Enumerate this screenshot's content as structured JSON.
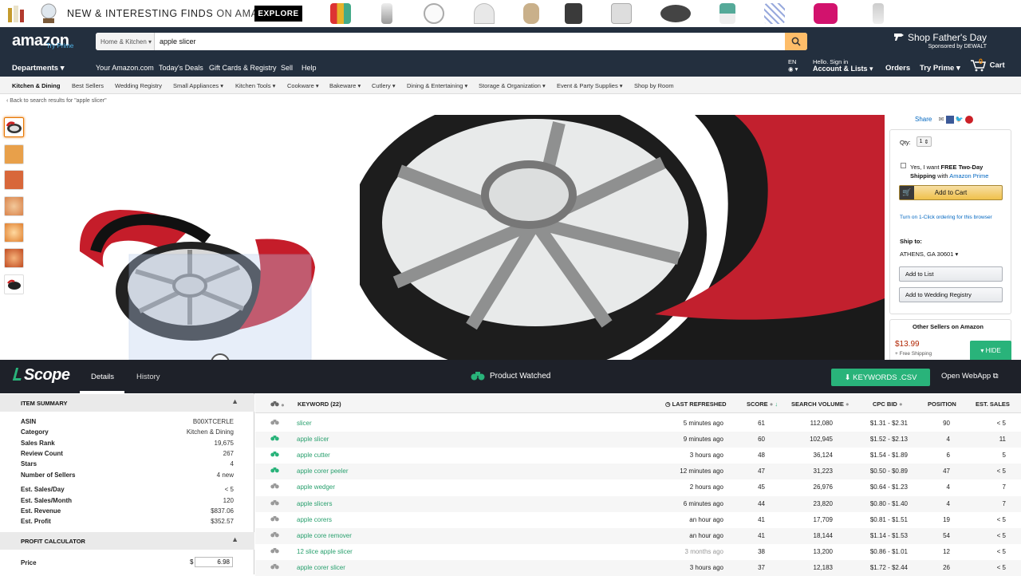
{
  "promo": {
    "text_a": "NEW & INTERESTING FINDS",
    "text_b": "ON AMAZON",
    "explore": "EXPLORE"
  },
  "header": {
    "logo": "amazon",
    "logo_sub": "Try Prime",
    "search_category": "Home & Kitchen",
    "search_query": "apple slicer",
    "fathers_day": "Shop Father's Day",
    "fathers_sponsor": "Sponsored by DEWALT",
    "departments": "Departments",
    "links": [
      "Your Amazon.com",
      "Today's Deals",
      "Gift Cards & Registry",
      "Sell",
      "Help"
    ],
    "lang": "EN",
    "hello": "Hello. Sign in",
    "account": "Account & Lists",
    "orders": "Orders",
    "prime": "Try Prime",
    "cart": "Cart",
    "cart_count": "0"
  },
  "subnav": [
    "Kitchen & Dining",
    "Best Sellers",
    "Wedding Registry",
    "Small Appliances",
    "Kitchen Tools",
    "Cookware",
    "Bakeware",
    "Cutlery",
    "Dining & Entertaining",
    "Storage & Organization",
    "Event & Party Supplies",
    "Shop by Room"
  ],
  "back_link": "‹ Back to search results for \"apple slicer\"",
  "buybox": {
    "share": "Share",
    "qty_label": "Qty:",
    "qty_value": "1",
    "prime_text_a": "Yes, I want",
    "prime_text_b": "FREE Two-Day",
    "prime_text_c": "Shipping",
    "prime_text_d": "with",
    "prime_text_e": "Amazon Prime",
    "add_to_cart": "Add to Cart",
    "one_click": "Turn on 1-Click ordering for this browser",
    "ship_to": "Ship to:",
    "location": "ATHENS, GA 30601",
    "add_list": "Add to List",
    "add_registry": "Add to Wedding Registry",
    "other_sellers": "Other Sellers on Amazon",
    "other_price": "$13.99",
    "other_ship": "+ Free Shipping",
    "hide": "HIDE"
  },
  "scope": {
    "logo": "Scope",
    "tab_details": "Details",
    "tab_history": "History",
    "watched": "Product Watched",
    "keywords_btn": "KEYWORDS .CSV",
    "open_webapp": "Open WebApp"
  },
  "summary": {
    "head": "ITEM SUMMARY",
    "rows": [
      {
        "k": "ASIN",
        "v": "B00XTCERLE"
      },
      {
        "k": "Category",
        "v": "Kitchen & Dining"
      },
      {
        "k": "Sales Rank",
        "v": "19,675"
      },
      {
        "k": "Review Count",
        "v": "267"
      },
      {
        "k": "Stars",
        "v": "4"
      },
      {
        "k": "Number of Sellers",
        "v": "4 new"
      },
      {
        "k": "Est. Sales/Day",
        "v": "< 5"
      },
      {
        "k": "Est. Sales/Month",
        "v": "120"
      },
      {
        "k": "Est. Revenue",
        "v": "$837.06"
      },
      {
        "k": "Est. Profit",
        "v": "$352.57"
      }
    ],
    "profit_head": "PROFIT CALCULATOR",
    "price_label": "Price",
    "price_currency": "$",
    "price_value": "6.98"
  },
  "keywords": {
    "headers": {
      "keyword": "KEYWORD (22)",
      "refreshed": "LAST REFRESHED",
      "score": "SCORE",
      "volume": "SEARCH VOLUME",
      "cpc": "CPC BID",
      "position": "POSITION",
      "sales": "EST. SALES"
    },
    "rows": [
      {
        "kw": "slicer",
        "ref": "5 minutes ago",
        "score": "61",
        "vol": "112,080",
        "cpc": "$1.31 - $2.31",
        "pos": "90",
        "sales": "< 5",
        "watched": false
      },
      {
        "kw": "apple slicer",
        "ref": "9 minutes ago",
        "score": "60",
        "vol": "102,945",
        "cpc": "$1.52 - $2.13",
        "pos": "4",
        "sales": "11",
        "watched": true
      },
      {
        "kw": "apple cutter",
        "ref": "3 hours ago",
        "score": "48",
        "vol": "36,124",
        "cpc": "$1.54 - $1.89",
        "pos": "6",
        "sales": "5",
        "watched": true
      },
      {
        "kw": "apple corer peeler",
        "ref": "12 minutes ago",
        "score": "47",
        "vol": "31,223",
        "cpc": "$0.50 - $0.89",
        "pos": "47",
        "sales": "< 5",
        "watched": true
      },
      {
        "kw": "apple wedger",
        "ref": "2 hours ago",
        "score": "45",
        "vol": "26,976",
        "cpc": "$0.64 - $1.23",
        "pos": "4",
        "sales": "7",
        "watched": false
      },
      {
        "kw": "apple slicers",
        "ref": "6 minutes ago",
        "score": "44",
        "vol": "23,820",
        "cpc": "$0.80 - $1.40",
        "pos": "4",
        "sales": "7",
        "watched": false
      },
      {
        "kw": "apple corers",
        "ref": "an hour ago",
        "score": "41",
        "vol": "17,709",
        "cpc": "$0.81 - $1.51",
        "pos": "19",
        "sales": "< 5",
        "watched": false
      },
      {
        "kw": "apple core remover",
        "ref": "an hour ago",
        "score": "41",
        "vol": "18,144",
        "cpc": "$1.14 - $1.53",
        "pos": "54",
        "sales": "< 5",
        "watched": false
      },
      {
        "kw": "12 slice apple slicer",
        "ref": "3 months ago",
        "score": "38",
        "vol": "13,200",
        "cpc": "$0.86 - $1.01",
        "pos": "12",
        "sales": "< 5",
        "watched": false
      },
      {
        "kw": "apple corer slicer",
        "ref": "3 hours ago",
        "score": "37",
        "vol": "12,183",
        "cpc": "$1.72 - $2.44",
        "pos": "26",
        "sales": "< 5",
        "watched": false
      }
    ]
  },
  "colors": {
    "amazon_nav": "#232f3e",
    "scope_bar": "#1e2129",
    "accent_green": "#29b37a",
    "amazon_orange": "#febd69"
  }
}
